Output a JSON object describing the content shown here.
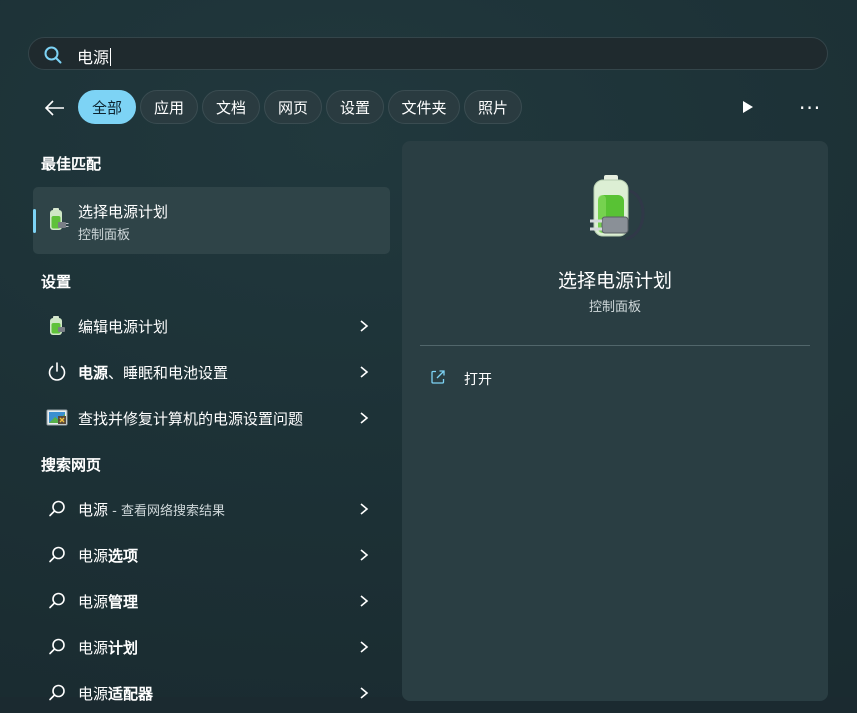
{
  "search": {
    "query": "电源"
  },
  "filters": {
    "tabs": [
      {
        "label": "全部",
        "active": true
      },
      {
        "label": "应用"
      },
      {
        "label": "文档"
      },
      {
        "label": "网页"
      },
      {
        "label": "设置"
      },
      {
        "label": "文件夹"
      },
      {
        "label": "照片"
      }
    ],
    "more": "···"
  },
  "best_match": {
    "heading": "最佳匹配",
    "title": "选择电源计划",
    "subtitle": "控制面板"
  },
  "settings": {
    "heading": "设置",
    "items": [
      {
        "label": "编辑电源计划"
      },
      {
        "label_bold": "电源",
        "label_rest": "、睡眠和电池设置"
      },
      {
        "label": "查找并修复计算机的电源设置问题"
      }
    ]
  },
  "web": {
    "heading": "搜索网页",
    "items": [
      {
        "label": "电源",
        "sub": " - 查看网络搜索结果"
      },
      {
        "label": "电源",
        "label_bold": "选项"
      },
      {
        "label": "电源",
        "label_bold": "管理"
      },
      {
        "label": "电源",
        "label_bold": "计划"
      },
      {
        "label": "电源",
        "label_bold": "适配器"
      }
    ]
  },
  "detail": {
    "title": "选择电源计划",
    "subtitle": "控制面板",
    "actions": [
      {
        "label": "打开"
      }
    ]
  },
  "colors": {
    "accent": "#7dd3f5",
    "panel": "#1d3237"
  }
}
